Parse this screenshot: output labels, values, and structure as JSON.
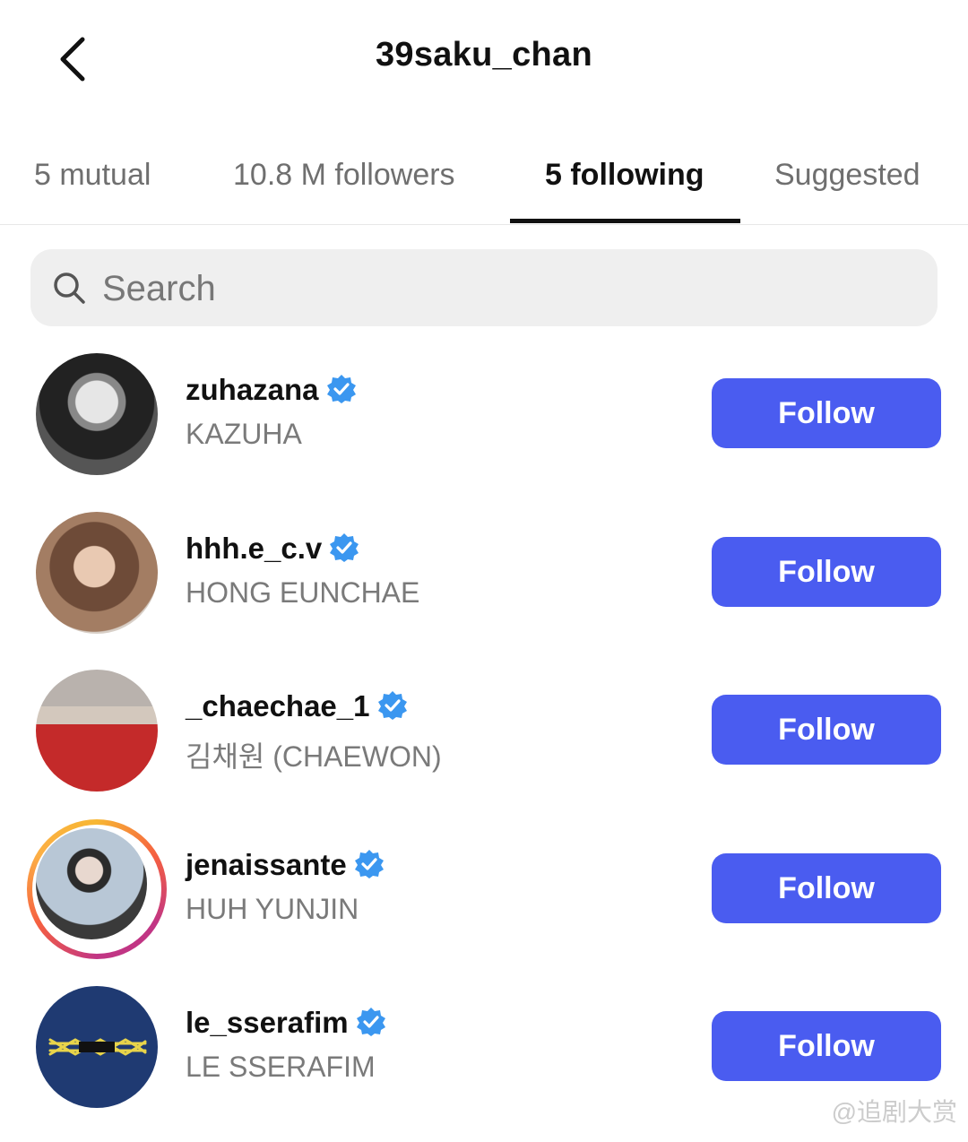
{
  "header": {
    "title": "39saku_chan"
  },
  "tabs": [
    {
      "label": "5 mutual"
    },
    {
      "label": "10.8 M followers"
    },
    {
      "label": "5 following"
    },
    {
      "label": "Suggested"
    }
  ],
  "active_tab_index": 2,
  "search": {
    "placeholder": "Search",
    "value": ""
  },
  "accounts": [
    {
      "username": "zuhazana",
      "full_name": "KAZUHA",
      "verified": true,
      "button": "Follow"
    },
    {
      "username": "hhh.e_c.v",
      "full_name": "HONG EUNCHAE",
      "verified": true,
      "button": "Follow"
    },
    {
      "username": "_chaechae_1",
      "full_name": "김채원 (CHAEWON)",
      "verified": true,
      "button": "Follow"
    },
    {
      "username": "jenaissante",
      "full_name": "HUH YUNJIN",
      "verified": true,
      "button": "Follow",
      "has_story_ring": true
    },
    {
      "username": "le_sserafim",
      "full_name": "LE SSERAFIM",
      "verified": true,
      "button": "Follow"
    }
  ],
  "watermark": "@追剧大赏",
  "colors": {
    "follow_button": "#4a5cf0",
    "verified_badge": "#3b97f0",
    "active_tab": "#111111"
  },
  "icons": {
    "back": "chevron-left-icon",
    "search": "search-icon",
    "verified": "verified-badge-icon"
  }
}
